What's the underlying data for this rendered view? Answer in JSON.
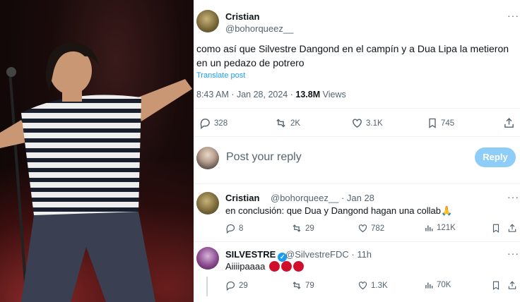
{
  "tweet": {
    "name": "Cristian",
    "handle": "@bohorqueez__",
    "text": "como así que Silvestre Dangond en el campín y a Dua Lipa la metieron en un pedazo de potrero",
    "translate": "Translate post",
    "time": "8:43 AM · Jan 28, 2024 · ",
    "views": "13.8M",
    "views_label": " Views",
    "replies": "328",
    "reposts": "2K",
    "likes": "3.1K",
    "bookmarks": "745"
  },
  "composer": {
    "placeholder": "Post your reply",
    "button": "Reply"
  },
  "replies": [
    {
      "name": "Cristian",
      "handle": "@bohorqueez__ · Jan 28",
      "text": "en conclusión: que Dua y Dangond hagan una collab🙏",
      "replies": "8",
      "reposts": "29",
      "likes": "782",
      "views": "121K"
    },
    {
      "name": "SILVESTRE",
      "handle": "@SilvestreFDC · 11h",
      "text": "Aiiiipaaaa",
      "replies": "29",
      "reposts": "79",
      "likes": "1.3K",
      "views": "70K"
    }
  ],
  "colors": {
    "accent": "#1d9bf0",
    "reply_button": "#8ecdf8",
    "muted": "#536471",
    "red_heart": "#d0102a"
  },
  "icons": [
    "more-icon",
    "reply-icon",
    "repost-icon",
    "like-icon",
    "bookmark-icon",
    "share-icon",
    "views-icon",
    "verified-icon"
  ]
}
